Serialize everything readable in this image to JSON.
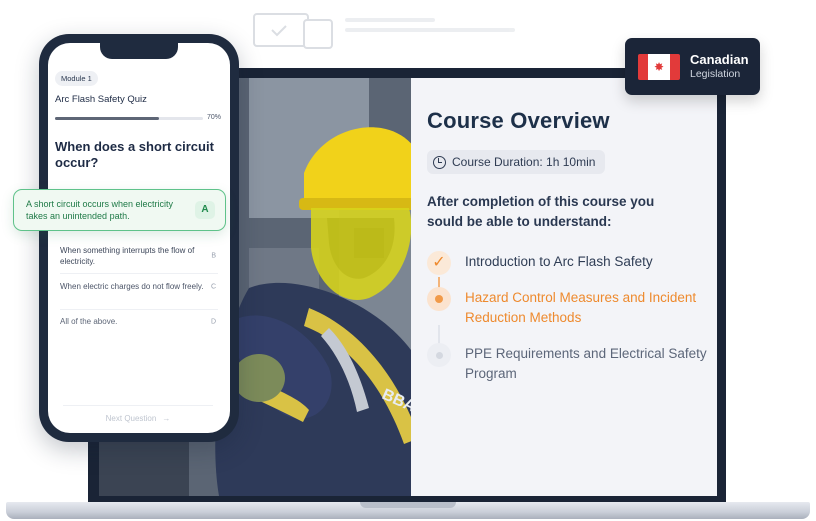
{
  "laptop": {
    "overview": {
      "title": "Course Overview",
      "duration": "Course Duration: 1h 10min",
      "intro": "After completion of this course you sould be able to understand:",
      "steps": [
        {
          "label": "Introduction to Arc Flash Safety",
          "state": "completed"
        },
        {
          "label": "Hazard Control Measures and Incident Reduction Methods",
          "state": "current"
        },
        {
          "label": "PPE Requirements and Electrical Safety Program",
          "state": "upcoming"
        }
      ]
    },
    "photo": {
      "vest_text": "BBA"
    }
  },
  "badge": {
    "title": "Canadian",
    "subtitle": "Legislation",
    "flag_icon": "maple-leaf-icon"
  },
  "phone": {
    "module": "Module 1",
    "quiz_title": "Arc Flash Safety Quiz",
    "progress_percent": 70,
    "progress_label": "70%",
    "question": "When does a short circuit occur?",
    "options": [
      {
        "text": "A short circuit occurs when electricity takes an unintended path.",
        "letter": "A",
        "selected": true
      },
      {
        "text": "When something interrupts the flow of electricity.",
        "letter": "B"
      },
      {
        "text": "When electric charges do not flow freely.",
        "letter": "C"
      },
      {
        "text": "All of the above.",
        "letter": "D"
      }
    ],
    "next_button": "Next Question",
    "next_arrow": "→"
  },
  "colors": {
    "accent_orange": "#ee8a2e",
    "correct_green": "#5fc28a",
    "navy": "#1b2538"
  }
}
